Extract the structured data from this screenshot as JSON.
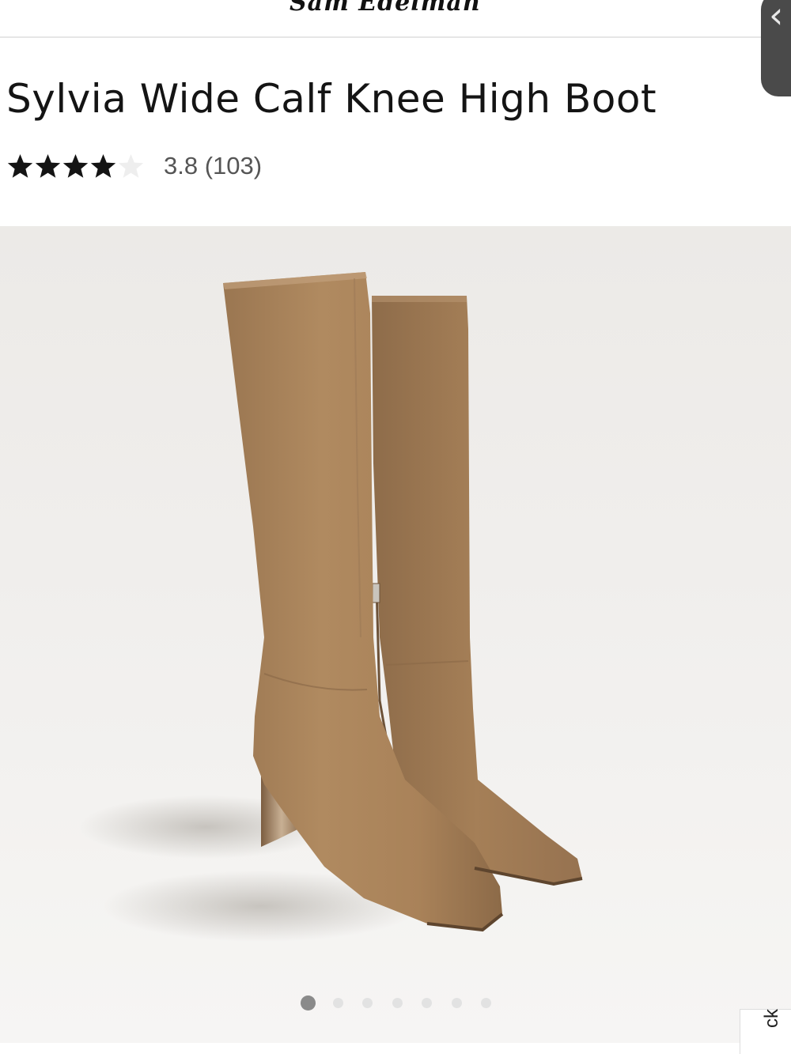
{
  "header": {
    "logo_text": "Sam Edelman"
  },
  "product": {
    "title": "Sylvia Wide Calf Knee High Boot",
    "rating": 3.8,
    "rating_text": "3.8 (103)",
    "filled_stars": 4,
    "total_stars": 5
  },
  "gallery": {
    "image_alt": "Sylvia Wide Calf Knee High Boot",
    "total_images": 7,
    "active_index": 0
  },
  "feedback_tab": {
    "label": "ck"
  },
  "colors": {
    "star_filled": "#141414",
    "star_empty": "#eeeeee",
    "boot_suede": "#a9825a",
    "dot_active": "#8a8a8a",
    "dot_inactive": "#e2e2e2"
  },
  "icons": {
    "side_handle": "chevron-left-icon",
    "rating": "star-icon"
  }
}
